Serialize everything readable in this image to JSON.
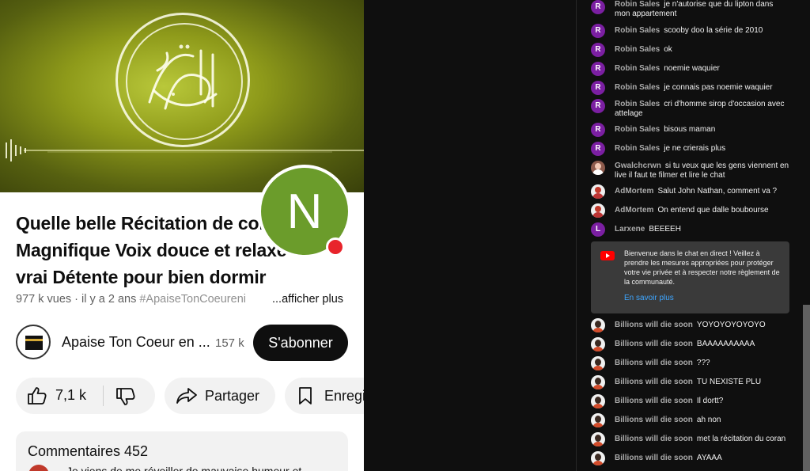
{
  "video": {
    "title_line1": "Quelle belle Récitation de cor",
    "title_line2": "Magnifique Voix douce et relaxe",
    "title_line3": "vrai Détente pour bien dormir",
    "meta": "977 k vues · il y a 2 ans",
    "hashtag": "#ApaiseTonCoeureni",
    "show_more": "...afficher plus",
    "creator_avatar_letter": "N"
  },
  "channel": {
    "name": "Apaise Ton Coeur en ...",
    "subscribers": "157 k",
    "subscribe_label": "S'abonner"
  },
  "actions": {
    "like_count": "7,1 k",
    "share_label": "Partager",
    "save_label": "Enregi"
  },
  "comments": {
    "header": "Commentaires 452",
    "preview": "Je viens de me réveiller de mauvaise humeur et"
  },
  "chat": {
    "messages": [
      {
        "author": "Robin Sales",
        "text": "je n'autorise que du lipton dans mon appartement",
        "avatar": "R"
      },
      {
        "author": "Robin Sales",
        "text": "scooby doo la série de 2010",
        "avatar": "R"
      },
      {
        "author": "Robin Sales",
        "text": "ok",
        "avatar": "R"
      },
      {
        "author": "Robin Sales",
        "text": "noemie waquier",
        "avatar": "R"
      },
      {
        "author": "Robin Sales",
        "text": "je connais pas noemie waquier",
        "avatar": "R"
      },
      {
        "author": "Robin Sales",
        "text": "cri d'homme sirop d'occasion avec attelage",
        "avatar": "R"
      },
      {
        "author": "Robin Sales",
        "text": "bisous maman",
        "avatar": "R"
      },
      {
        "author": "Robin Sales",
        "text": "je ne crierais plus",
        "avatar": "R"
      },
      {
        "author": "Gwalchcrwn",
        "text": "si tu veux que les gens viennent en live il faut te filmer et lire le chat",
        "avatar": ""
      },
      {
        "author": "AdMortem",
        "text": "Salut John Nathan, comment va ?",
        "avatar": ""
      },
      {
        "author": "AdMortem",
        "text": "On entend que dalle boubourse",
        "avatar": ""
      },
      {
        "author": "Larxene",
        "text": "BEEEEH",
        "avatar": "L"
      }
    ],
    "notice_text": "Bienvenue dans le chat en direct ! Veillez à prendre les mesures appropriées pour protéger votre vie privée et à respecter notre règlement de la communauté.",
    "notice_link": "En savoir plus",
    "messages2": [
      {
        "author": "Billions will die soon",
        "text": "YOYOYOYOYOYO"
      },
      {
        "author": "Billions will die soon",
        "text": "BAAAAAAAAAA"
      },
      {
        "author": "Billions will die soon",
        "text": "???"
      },
      {
        "author": "Billions will die soon",
        "text": "TU NEXISTE PLU"
      },
      {
        "author": "Billions will die soon",
        "text": "Il dortt?"
      },
      {
        "author": "Billions will die soon",
        "text": "ah non"
      },
      {
        "author": "Billions will die soon",
        "text": "met la récitation du coran"
      },
      {
        "author": "Billions will die soon",
        "text": "AYAAA"
      }
    ]
  }
}
